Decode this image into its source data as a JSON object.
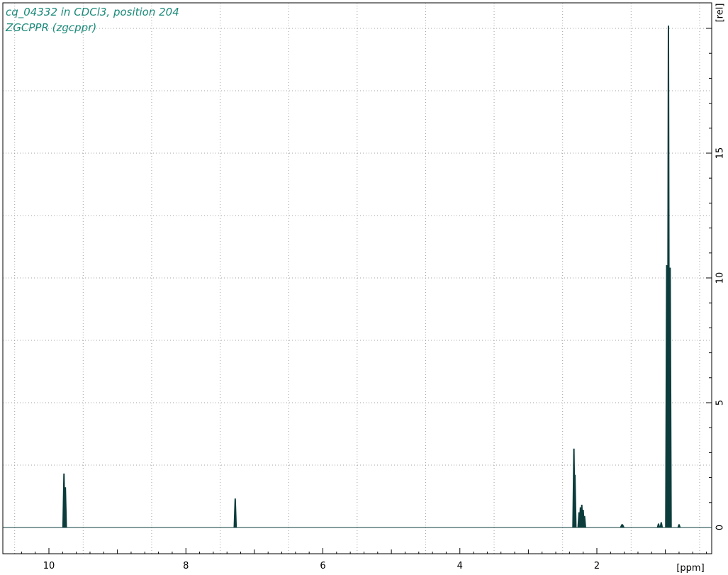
{
  "chart_data": {
    "type": "line",
    "title": "cq_04332 in CDCl3, position 204",
    "subtitle": "ZGCPPR (zgcppr)",
    "xlabel": "[ppm]",
    "ylabel": "[rel]",
    "x_reversed": true,
    "xlim": [
      10.5,
      -0.4
    ],
    "ylim": [
      -1.1,
      21.0
    ],
    "x_ticks": [
      10,
      8,
      6,
      4,
      2
    ],
    "x_tick_labels": [
      "10",
      "8",
      "6",
      "4",
      "2"
    ],
    "y_ticks": [
      0,
      5,
      10,
      15
    ],
    "y_tick_labels": [
      "0",
      "5",
      "10",
      "15"
    ],
    "grid": true,
    "grid_style": "dotted",
    "line_color": "#0c3c3c",
    "title_color": "#1a8a78",
    "peaks": [
      {
        "ppm": 9.78,
        "height": 2.15,
        "width": 0.02
      },
      {
        "ppm": 9.76,
        "height": 1.6,
        "width": 0.02
      },
      {
        "ppm": 7.28,
        "height": 1.15,
        "width": 0.02
      },
      {
        "ppm": 2.335,
        "height": 3.15,
        "width": 0.02
      },
      {
        "ppm": 2.32,
        "height": 2.1,
        "width": 0.02
      },
      {
        "ppm": 2.26,
        "height": 0.6,
        "width": 0.02
      },
      {
        "ppm": 2.24,
        "height": 0.8,
        "width": 0.02
      },
      {
        "ppm": 2.22,
        "height": 0.9,
        "width": 0.02
      },
      {
        "ppm": 2.2,
        "height": 0.7,
        "width": 0.02
      },
      {
        "ppm": 2.18,
        "height": 0.45,
        "width": 0.02
      },
      {
        "ppm": 1.63,
        "height": 0.12,
        "width": 0.03
      },
      {
        "ppm": 1.1,
        "height": 0.15,
        "width": 0.02
      },
      {
        "ppm": 1.06,
        "height": 0.2,
        "width": 0.02
      },
      {
        "ppm": 0.98,
        "height": 10.5,
        "width": 0.02
      },
      {
        "ppm": 0.955,
        "height": 20.1,
        "width": 0.02
      },
      {
        "ppm": 0.93,
        "height": 10.4,
        "width": 0.02
      },
      {
        "ppm": 0.8,
        "height": 0.12,
        "width": 0.02
      }
    ]
  }
}
